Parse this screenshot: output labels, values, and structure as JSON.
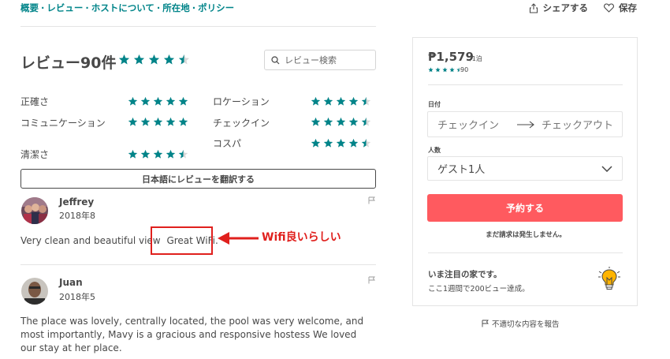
{
  "nav": {
    "links": [
      "概要",
      "レビュー",
      "ホストについて",
      "所在地",
      "ポリシー"
    ],
    "separator": "·",
    "share_label": "シェアする",
    "save_label": "保存"
  },
  "reviews": {
    "title": "レビュー90件",
    "overall_rating": 4.5,
    "search_placeholder": "レビュー検索",
    "categories": [
      {
        "label": "正確さ",
        "rating": 5
      },
      {
        "label": "コミュニケーション",
        "rating": 5
      },
      {
        "label": "清潔さ",
        "rating": 4.5
      },
      {
        "label": "ロケーション",
        "rating": 4.5
      },
      {
        "label": "チェックイン",
        "rating": 4.5
      },
      {
        "label": "コスパ",
        "rating": 4.5
      }
    ],
    "translate_button": "日本語にレビューを翻訳する",
    "items": [
      {
        "name": "Jeffrey",
        "date": "2018年8",
        "text_before": "Very clean and beautiful view",
        "text_highlight": "Great WiFi",
        "text_after": "."
      },
      {
        "name": "Juan",
        "date": "2018年5",
        "text": "The place was lovely, centrally located, the pool was very welcome, and most importantly, Mavy is a gracious and responsive hostess We loved our stay at her place."
      }
    ]
  },
  "annotation": {
    "label": "Wifi良いらしい",
    "color": "#e0201d"
  },
  "booking": {
    "price": "₱1,579",
    "per_night": "/1泊",
    "rating": 4.5,
    "review_count": "90",
    "date_label": "日付",
    "checkin_placeholder": "チェックイン",
    "checkout_placeholder": "チェックアウト",
    "guests_label": "人数",
    "guests_value": "ゲスト1人",
    "book_button": "予約する",
    "no_charge_note": "まだ請求は発生しません。",
    "notice_title": "いま注目の家です。",
    "notice_subtitle": "ここ1週間で200ビュー達成。",
    "report_label": "不適切な内容を報告"
  },
  "colors": {
    "teal": "#008489",
    "text": "#484848",
    "book_button": "#ff5a5f",
    "annotation_red": "#e0201d"
  }
}
